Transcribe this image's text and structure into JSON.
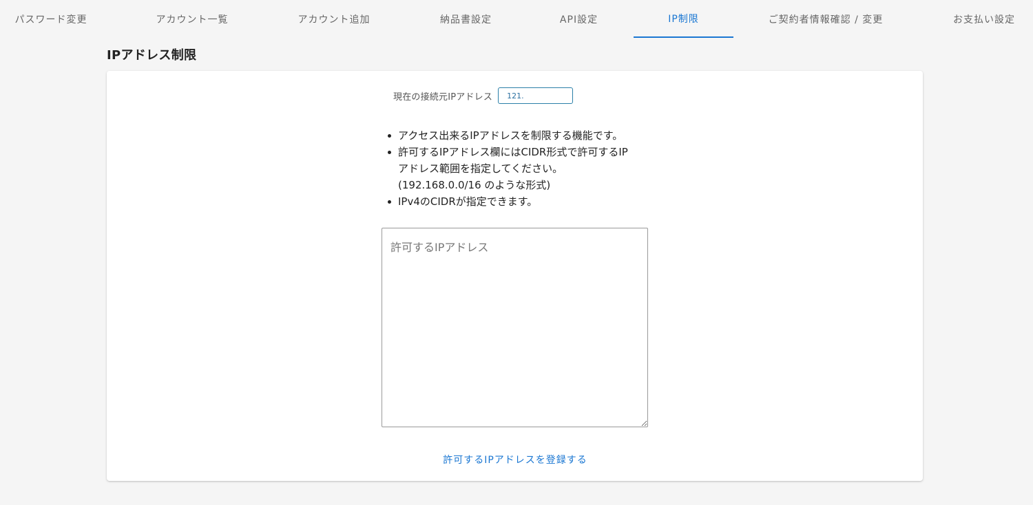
{
  "tabs": [
    {
      "label": "パスワード変更",
      "active": false
    },
    {
      "label": "アカウント一覧",
      "active": false
    },
    {
      "label": "アカウント追加",
      "active": false
    },
    {
      "label": "納品書設定",
      "active": false
    },
    {
      "label": "API設定",
      "active": false
    },
    {
      "label": "IP制限",
      "active": true
    },
    {
      "label": "ご契約者情報確認 / 変更",
      "active": false
    },
    {
      "label": "お支払い設定",
      "active": false
    }
  ],
  "section": {
    "title": "IPアドレス制限"
  },
  "current_ip": {
    "label": "現在の接続元IPアドレス",
    "value": "121."
  },
  "notes": [
    "アクセス出来るIPアドレスを制限する機能です。",
    "許可するIPアドレス欄にはCIDR形式で許可するIP\nアドレス範囲を指定してください。\n(192.168.0.0/16 のような形式)",
    "IPv4のCIDRが指定できます。"
  ],
  "allowed_ip_field": {
    "placeholder": "許可するIPアドレス",
    "value": ""
  },
  "register_button": {
    "label": "許可するIPアドレスを登録する"
  },
  "colors": {
    "accent": "#1976d2",
    "background": "#f5f5f5",
    "card": "#ffffff",
    "ip_box_border": "#2a7fa8"
  }
}
